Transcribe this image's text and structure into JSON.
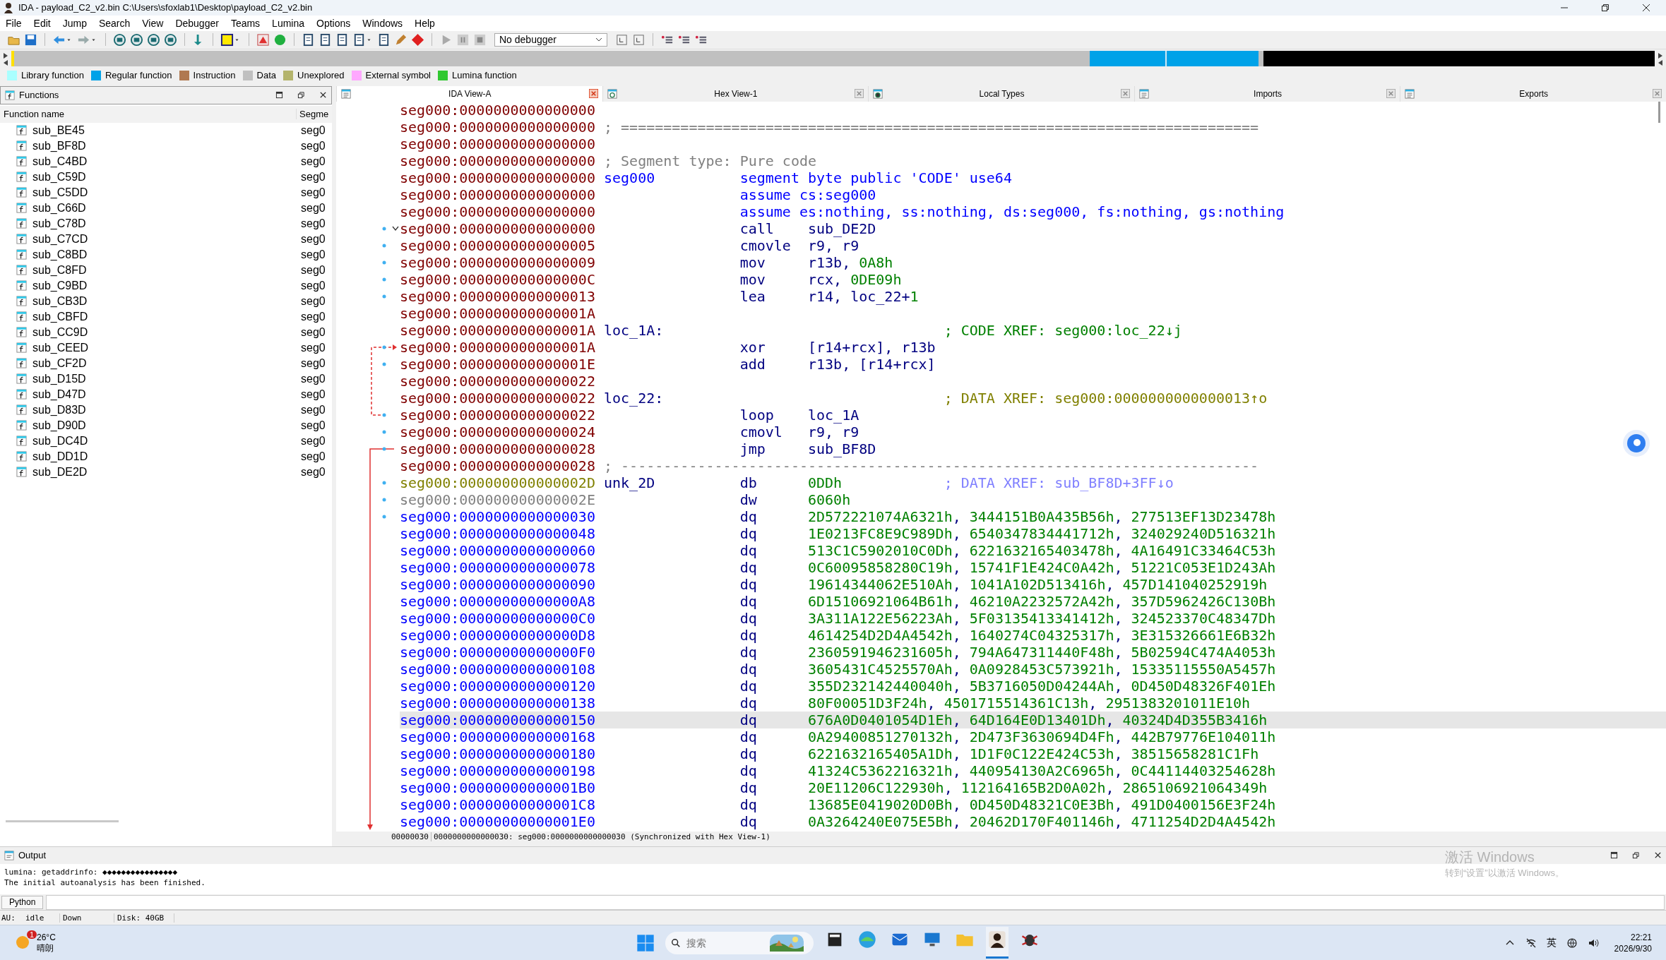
{
  "window": {
    "title": "IDA - payload_C2_v2.bin C:\\Users\\sfoxlab1\\Desktop\\payload_C2_v2.bin"
  },
  "menu": [
    "File",
    "Edit",
    "Jump",
    "Search",
    "View",
    "Debugger",
    "Teams",
    "Lumina",
    "Options",
    "Windows",
    "Help"
  ],
  "toolbar": {
    "debugger_select": "No debugger"
  },
  "legend": [
    {
      "label": "Library function",
      "color": "#aaffff"
    },
    {
      "label": "Regular function",
      "color": "#00a2e8"
    },
    {
      "label": "Instruction",
      "color": "#b07850"
    },
    {
      "label": "Data",
      "color": "#c0c0c0"
    },
    {
      "label": "Unexplored",
      "color": "#b4b46c"
    },
    {
      "label": "External symbol",
      "color": "#ffa8ff"
    },
    {
      "label": "Lumina function",
      "color": "#30c830"
    }
  ],
  "functions": {
    "title": "Functions",
    "columns": [
      "Function name",
      "Segme"
    ],
    "rows": [
      {
        "name": "sub_BE45",
        "segment": "seg0"
      },
      {
        "name": "sub_BF8D",
        "segment": "seg0"
      },
      {
        "name": "sub_C4BD",
        "segment": "seg0"
      },
      {
        "name": "sub_C59D",
        "segment": "seg0"
      },
      {
        "name": "sub_C5DD",
        "segment": "seg0"
      },
      {
        "name": "sub_C66D",
        "segment": "seg0"
      },
      {
        "name": "sub_C78D",
        "segment": "seg0"
      },
      {
        "name": "sub_C7CD",
        "segment": "seg0"
      },
      {
        "name": "sub_C8BD",
        "segment": "seg0"
      },
      {
        "name": "sub_C8FD",
        "segment": "seg0"
      },
      {
        "name": "sub_C9BD",
        "segment": "seg0"
      },
      {
        "name": "sub_CB3D",
        "segment": "seg0"
      },
      {
        "name": "sub_CBFD",
        "segment": "seg0"
      },
      {
        "name": "sub_CC9D",
        "segment": "seg0"
      },
      {
        "name": "sub_CEED",
        "segment": "seg0"
      },
      {
        "name": "sub_CF2D",
        "segment": "seg0"
      },
      {
        "name": "sub_D15D",
        "segment": "seg0"
      },
      {
        "name": "sub_D47D",
        "segment": "seg0"
      },
      {
        "name": "sub_D83D",
        "segment": "seg0"
      },
      {
        "name": "sub_D90D",
        "segment": "seg0"
      },
      {
        "name": "sub_DC4D",
        "segment": "seg0"
      },
      {
        "name": "sub_DD1D",
        "segment": "seg0"
      },
      {
        "name": "sub_DE2D",
        "segment": "seg0"
      }
    ]
  },
  "tabs": [
    {
      "label": "IDA View-A",
      "selected": true
    },
    {
      "label": "Hex View-1",
      "selected": false
    },
    {
      "label": "Local Types",
      "selected": false
    },
    {
      "label": "Imports",
      "selected": false
    },
    {
      "label": "Exports",
      "selected": false
    }
  ],
  "listing": {
    "lines": [
      {
        "address": "seg000:0000000000000000",
        "kind": "code",
        "selected": false,
        "marker": false
      },
      {
        "address": "seg000:0000000000000000",
        "kind": "code",
        "comment": "; ===========================================================================",
        "color": "#808080",
        "selected": false,
        "marker": false
      },
      {
        "address": "seg000:0000000000000000",
        "kind": "code",
        "selected": false,
        "marker": false
      },
      {
        "address": "seg000:0000000000000000",
        "kind": "code",
        "comment": "; Segment type: Pure code",
        "color": "#808080",
        "selected": false,
        "marker": false
      },
      {
        "address": "seg000:0000000000000000",
        "kind": "directive",
        "label": "seg000",
        "text": "segment byte public 'CODE' use64",
        "selected": false,
        "marker": false
      },
      {
        "address": "seg000:0000000000000000",
        "kind": "directive",
        "text": "assume cs:seg000",
        "selected": false,
        "marker": false
      },
      {
        "address": "seg000:0000000000000000",
        "kind": "directive",
        "text": "assume es:nothing, ss:nothing, ds:seg000, fs:nothing, gs:nothing",
        "selected": false,
        "marker": false
      },
      {
        "address": "seg000:0000000000000000",
        "kind": "code",
        "mnemonic": "call",
        "operands": [
          {
            "t": "sub_DE2D",
            "kind": "reg"
          }
        ],
        "selected": false,
        "marker": true
      },
      {
        "address": "seg000:0000000000000005",
        "kind": "code",
        "mnemonic": "cmovle",
        "operands": [
          {
            "t": "r9, r9",
            "kind": "reg"
          }
        ],
        "selected": false,
        "marker": true
      },
      {
        "address": "seg000:0000000000000009",
        "kind": "code",
        "mnemonic": "mov",
        "operands": [
          {
            "t": "r13b, ",
            "kind": "reg"
          },
          {
            "t": "0A8h",
            "kind": "num"
          }
        ],
        "selected": false,
        "marker": true
      },
      {
        "address": "seg000:000000000000000C",
        "kind": "code",
        "mnemonic": "mov",
        "operands": [
          {
            "t": "rcx, ",
            "kind": "reg"
          },
          {
            "t": "0DE09h",
            "kind": "num"
          }
        ],
        "selected": false,
        "marker": true
      },
      {
        "address": "seg000:0000000000000013",
        "kind": "code",
        "mnemonic": "lea",
        "operands": [
          {
            "t": "r14, loc_22+",
            "kind": "reg"
          },
          {
            "t": "1",
            "kind": "num"
          }
        ],
        "selected": false,
        "marker": true
      },
      {
        "address": "seg000:000000000000001A",
        "kind": "code",
        "selected": false,
        "marker": false
      },
      {
        "address": "seg000:000000000000001A",
        "kind": "code",
        "label": "loc_1A:",
        "comment": "; CODE XREF: seg000:loc_22↓j",
        "color": "#008000",
        "selected": false,
        "marker": false
      },
      {
        "address": "seg000:000000000000001A",
        "kind": "code",
        "mnemonic": "xor",
        "operands": [
          {
            "t": "[r14+rcx], r13b",
            "kind": "reg"
          }
        ],
        "selected": false,
        "marker": true
      },
      {
        "address": "seg000:000000000000001E",
        "kind": "code",
        "mnemonic": "add",
        "operands": [
          {
            "t": "r13b, [r14+rcx]",
            "kind": "reg"
          }
        ],
        "selected": false,
        "marker": true
      },
      {
        "address": "seg000:0000000000000022",
        "kind": "code",
        "selected": false,
        "marker": false
      },
      {
        "address": "seg000:0000000000000022",
        "kind": "code",
        "label": "loc_22:",
        "comment": "; DATA XREF: seg000:0000000000000013↑o",
        "color": "#808000",
        "selected": false,
        "marker": false
      },
      {
        "address": "seg000:0000000000000022",
        "kind": "code",
        "mnemonic": "loop",
        "operands": [
          {
            "t": "loc_1A",
            "kind": "reg"
          }
        ],
        "selected": false,
        "marker": true
      },
      {
        "address": "seg000:0000000000000024",
        "kind": "code",
        "mnemonic": "cmovl",
        "operands": [
          {
            "t": "r9, r9",
            "kind": "reg"
          }
        ],
        "selected": false,
        "marker": true
      },
      {
        "address": "seg000:0000000000000028",
        "kind": "code",
        "mnemonic": "jmp",
        "operands": [
          {
            "t": "sub_BF8D",
            "kind": "reg"
          }
        ],
        "selected": false,
        "marker": true
      },
      {
        "address": "seg000:0000000000000028",
        "kind": "code",
        "comment": "; ---------------------------------------------------------------------------",
        "color": "#808080",
        "selected": false,
        "marker": false
      },
      {
        "address": "seg000:000000000000002D",
        "kind": "data_label",
        "label": "unk_2D",
        "mnemonic": "db",
        "operands": [
          {
            "t": "0DDh",
            "kind": "num"
          }
        ],
        "comment": "; DATA XREF: sub_BF8D+3FF↓o",
        "color": "#8080ff",
        "selected": false,
        "marker": true
      },
      {
        "address": "seg000:000000000000002E",
        "kind": "unexplored",
        "mnemonic": "dw",
        "operands": [
          {
            "t": "6060h",
            "kind": "num"
          }
        ],
        "selected": false,
        "marker": true
      },
      {
        "address": "seg000:0000000000000030",
        "kind": "data",
        "mnemonic": "dq",
        "operands": [
          {
            "t": "2D572221074A6321h",
            "kind": "num"
          },
          {
            "t": ", ",
            "kind": "reg"
          },
          {
            "t": "3444151B0A435B56h",
            "kind": "num"
          },
          {
            "t": ", ",
            "kind": "reg"
          },
          {
            "t": "277513EF13D23478h",
            "kind": "num"
          }
        ],
        "selected": false,
        "marker": true
      },
      {
        "address": "seg000:0000000000000048",
        "kind": "data",
        "mnemonic": "dq",
        "operands": [
          {
            "t": "1E0213FC8E9C989Dh",
            "kind": "num"
          },
          {
            "t": ", ",
            "kind": "reg"
          },
          {
            "t": "6540347834441712h",
            "kind": "num"
          },
          {
            "t": ", ",
            "kind": "reg"
          },
          {
            "t": "324029240D516321h",
            "kind": "num"
          }
        ],
        "selected": false,
        "marker": false
      },
      {
        "address": "seg000:0000000000000060",
        "kind": "data",
        "mnemonic": "dq",
        "operands": [
          {
            "t": "513C1C5902010C0Dh",
            "kind": "num"
          },
          {
            "t": ", ",
            "kind": "reg"
          },
          {
            "t": "6221632165403478h",
            "kind": "num"
          },
          {
            "t": ", ",
            "kind": "reg"
          },
          {
            "t": "4A16491C33464C53h",
            "kind": "num"
          }
        ],
        "selected": false,
        "marker": false
      },
      {
        "address": "seg000:0000000000000078",
        "kind": "data",
        "mnemonic": "dq",
        "operands": [
          {
            "t": "0C60095858280C19h",
            "kind": "num"
          },
          {
            "t": ", ",
            "kind": "reg"
          },
          {
            "t": "15741F1E424C0A42h",
            "kind": "num"
          },
          {
            "t": ", ",
            "kind": "reg"
          },
          {
            "t": "51221C053E1D243Ah",
            "kind": "num"
          }
        ],
        "selected": false,
        "marker": false
      },
      {
        "address": "seg000:0000000000000090",
        "kind": "data",
        "mnemonic": "dq",
        "operands": [
          {
            "t": "19614344062E510Ah",
            "kind": "num"
          },
          {
            "t": ", ",
            "kind": "reg"
          },
          {
            "t": "1041A102D513416h",
            "kind": "num"
          },
          {
            "t": ", ",
            "kind": "reg"
          },
          {
            "t": "457D141040252919h",
            "kind": "num"
          }
        ],
        "selected": false,
        "marker": false
      },
      {
        "address": "seg000:00000000000000A8",
        "kind": "data",
        "mnemonic": "dq",
        "operands": [
          {
            "t": "6D15106921064B61h",
            "kind": "num"
          },
          {
            "t": ", ",
            "kind": "reg"
          },
          {
            "t": "46210A2232572A42h",
            "kind": "num"
          },
          {
            "t": ", ",
            "kind": "reg"
          },
          {
            "t": "357D5962426C130Bh",
            "kind": "num"
          }
        ],
        "selected": false,
        "marker": false
      },
      {
        "address": "seg000:00000000000000C0",
        "kind": "data",
        "mnemonic": "dq",
        "operands": [
          {
            "t": "3A311A122E56223Ah",
            "kind": "num"
          },
          {
            "t": ", ",
            "kind": "reg"
          },
          {
            "t": "5F03135413341412h",
            "kind": "num"
          },
          {
            "t": ", ",
            "kind": "reg"
          },
          {
            "t": "324523370C48347Dh",
            "kind": "num"
          }
        ],
        "selected": false,
        "marker": false
      },
      {
        "address": "seg000:00000000000000D8",
        "kind": "data",
        "mnemonic": "dq",
        "operands": [
          {
            "t": "4614254D2D4A4542h",
            "kind": "num"
          },
          {
            "t": ", ",
            "kind": "reg"
          },
          {
            "t": "1640274C04325317h",
            "kind": "num"
          },
          {
            "t": ", ",
            "kind": "reg"
          },
          {
            "t": "3E315326661E6B32h",
            "kind": "num"
          }
        ],
        "selected": false,
        "marker": false
      },
      {
        "address": "seg000:00000000000000F0",
        "kind": "data",
        "mnemonic": "dq",
        "operands": [
          {
            "t": "2360591946231605h",
            "kind": "num"
          },
          {
            "t": ", ",
            "kind": "reg"
          },
          {
            "t": "794A647311440F48h",
            "kind": "num"
          },
          {
            "t": ", ",
            "kind": "reg"
          },
          {
            "t": "5B02594C474A4053h",
            "kind": "num"
          }
        ],
        "selected": false,
        "marker": false
      },
      {
        "address": "seg000:0000000000000108",
        "kind": "data",
        "mnemonic": "dq",
        "operands": [
          {
            "t": "3605431C4525570Ah",
            "kind": "num"
          },
          {
            "t": ", ",
            "kind": "reg"
          },
          {
            "t": "0A0928453C573921h",
            "kind": "num"
          },
          {
            "t": ", ",
            "kind": "reg"
          },
          {
            "t": "15335115550A5457h",
            "kind": "num"
          }
        ],
        "selected": false,
        "marker": false
      },
      {
        "address": "seg000:0000000000000120",
        "kind": "data",
        "mnemonic": "dq",
        "operands": [
          {
            "t": "355D232142440040h",
            "kind": "num"
          },
          {
            "t": ", ",
            "kind": "reg"
          },
          {
            "t": "5B3716050D04244Ah",
            "kind": "num"
          },
          {
            "t": ", ",
            "kind": "reg"
          },
          {
            "t": "0D450D48326F401Eh",
            "kind": "num"
          }
        ],
        "selected": false,
        "marker": false
      },
      {
        "address": "seg000:0000000000000138",
        "kind": "data",
        "mnemonic": "dq",
        "operands": [
          {
            "t": "80F00051D3F24h",
            "kind": "num"
          },
          {
            "t": ", ",
            "kind": "reg"
          },
          {
            "t": "4501715514361C13h",
            "kind": "num"
          },
          {
            "t": ", ",
            "kind": "reg"
          },
          {
            "t": "2951383201011E10h",
            "kind": "num"
          }
        ],
        "selected": false,
        "marker": false
      },
      {
        "address": "seg000:0000000000000150",
        "kind": "data",
        "mnemonic": "dq",
        "operands": [
          {
            "t": "676A0D0401054D1Eh",
            "kind": "num"
          },
          {
            "t": ", ",
            "kind": "reg"
          },
          {
            "t": "64D164E0D13401Dh",
            "kind": "num"
          },
          {
            "t": ", ",
            "kind": "reg"
          },
          {
            "t": "40324D4D355B3416h",
            "kind": "num"
          }
        ],
        "selected": true,
        "marker": false
      },
      {
        "address": "seg000:0000000000000168",
        "kind": "data",
        "mnemonic": "dq",
        "operands": [
          {
            "t": "0A29400851270132h",
            "kind": "num"
          },
          {
            "t": ", ",
            "kind": "reg"
          },
          {
            "t": "2D473F3630694D4Fh",
            "kind": "num"
          },
          {
            "t": ", ",
            "kind": "reg"
          },
          {
            "t": "442B79776E104011h",
            "kind": "num"
          }
        ],
        "selected": false,
        "marker": false
      },
      {
        "address": "seg000:0000000000000180",
        "kind": "data",
        "mnemonic": "dq",
        "operands": [
          {
            "t": "6221632165405A1Dh",
            "kind": "num"
          },
          {
            "t": ", ",
            "kind": "reg"
          },
          {
            "t": "1D1F0C122E424C53h",
            "kind": "num"
          },
          {
            "t": ", ",
            "kind": "reg"
          },
          {
            "t": "38515658281C1Fh",
            "kind": "num"
          }
        ],
        "selected": false,
        "marker": false
      },
      {
        "address": "seg000:0000000000000198",
        "kind": "data",
        "mnemonic": "dq",
        "operands": [
          {
            "t": "41324C5362216321h",
            "kind": "num"
          },
          {
            "t": ", ",
            "kind": "reg"
          },
          {
            "t": "440954130A2C6965h",
            "kind": "num"
          },
          {
            "t": ", ",
            "kind": "reg"
          },
          {
            "t": "0C44114403254628h",
            "kind": "num"
          }
        ],
        "selected": false,
        "marker": false
      },
      {
        "address": "seg000:00000000000001B0",
        "kind": "data",
        "mnemonic": "dq",
        "operands": [
          {
            "t": "20E11206C122930h",
            "kind": "num"
          },
          {
            "t": ", ",
            "kind": "reg"
          },
          {
            "t": "112164165B2D0A02h",
            "kind": "num"
          },
          {
            "t": ", ",
            "kind": "reg"
          },
          {
            "t": "2865106921064349h",
            "kind": "num"
          }
        ],
        "selected": false,
        "marker": false
      },
      {
        "address": "seg000:00000000000001C8",
        "kind": "data",
        "mnemonic": "dq",
        "operands": [
          {
            "t": "13685E0419020D0Bh",
            "kind": "num"
          },
          {
            "t": ", ",
            "kind": "reg"
          },
          {
            "t": "0D450D48321C0E3Bh",
            "kind": "num"
          },
          {
            "t": ", ",
            "kind": "reg"
          },
          {
            "t": "491D0400156E3F24h",
            "kind": "num"
          }
        ],
        "selected": false,
        "marker": false
      },
      {
        "address": "seg000:00000000000001E0",
        "kind": "data",
        "mnemonic": "dq",
        "operands": [
          {
            "t": "0A3264240E075E5Bh",
            "kind": "num"
          },
          {
            "t": ", ",
            "kind": "reg"
          },
          {
            "t": "20462D170F401146h",
            "kind": "num"
          },
          {
            "t": ", ",
            "kind": "reg"
          },
          {
            "t": "4711254D2D4A4542h",
            "kind": "num"
          }
        ],
        "selected": false,
        "marker": false
      }
    ],
    "status": [
      "00000030",
      "0000000000000030: seg000:0000000000000030 (Synchronized with Hex View-1)"
    ]
  },
  "output": {
    "title": "Output",
    "lines": [
      "lumina: getaddrinfo: ◆◆◆◆◆◆◆◆◆◆◆◆◆◆◆◆",
      "The initial autoanalysis has been finished."
    ],
    "language_button": "Python"
  },
  "activation_notice": {
    "title": "激活 Windows",
    "hint": "转到“设置”以激活 Windows。"
  },
  "status_bar": [
    "AU:",
    "idle",
    "Down",
    "Disk: 40GB"
  ],
  "taskbar": {
    "weather": {
      "badge": "1",
      "temperature": "26°C",
      "condition": "晴朗"
    },
    "search": {
      "placeholder": "搜索"
    },
    "apps": [
      {
        "kind": "window",
        "selected": false
      },
      {
        "kind": "browser",
        "selected": false
      },
      {
        "kind": "mail",
        "selected": false
      },
      {
        "kind": "monitor",
        "selected": false
      },
      {
        "kind": "folder",
        "selected": false
      },
      {
        "kind": "avatar",
        "selected": true
      },
      {
        "kind": "bug",
        "selected": false
      }
    ],
    "ime": "英",
    "time": "22:21",
    "date": "2026/9/30"
  }
}
